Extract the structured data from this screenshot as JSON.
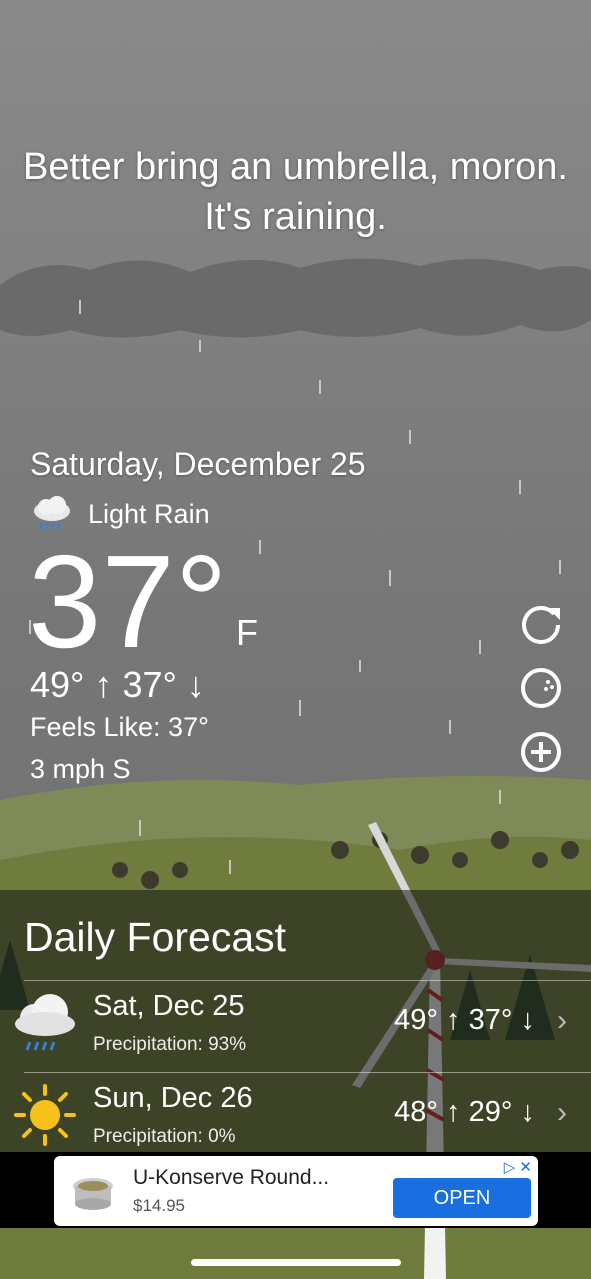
{
  "headline": "Better bring an umbrella, moron. It's raining.",
  "current": {
    "date": "Saturday, December 25",
    "condition_icon": "cloud-rain-icon",
    "condition": "Light Rain",
    "temperature": "37°",
    "unit": "F",
    "high_low": "49° ↑  37° ↓",
    "feels_like": "Feels Like: 37°",
    "wind": "3 mph S"
  },
  "side_buttons": [
    "refresh-icon",
    "share-icon",
    "add-icon"
  ],
  "forecast": {
    "title": "Daily Forecast",
    "days": [
      {
        "day": "Sat, Dec 25",
        "precip": "Precipitation: 93%",
        "temps": "49° ↑  37° ↓",
        "icon": "cloud-rain-icon"
      },
      {
        "day": "Sun, Dec 26",
        "precip": "Precipitation: 0%",
        "temps": "48° ↑  29° ↓",
        "icon": "sun-icon"
      }
    ]
  },
  "ad": {
    "title": "U-Konserve Round...",
    "price": "$14.95",
    "cta": "OPEN"
  },
  "colors": {
    "sky": "#7a7a7a",
    "hills": "#6b7a40",
    "ad_button": "#1a6fe0",
    "sun": "#f6c11a"
  }
}
